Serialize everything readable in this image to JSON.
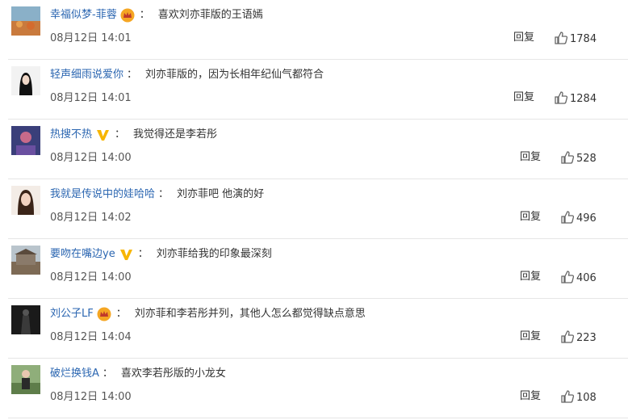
{
  "comments": [
    {
      "username": "幸福似梦-菲蓉",
      "badge": "crown-badge",
      "text": "喜欢刘亦菲版的王语嫣",
      "time": "08月12日 14:01",
      "reply": "回复",
      "likes": "1784"
    },
    {
      "username": "轻声细雨说爱你",
      "badge": "",
      "text": "刘亦菲版的，因为长相年纪仙气都符合",
      "time": "08月12日 14:01",
      "reply": "回复",
      "likes": "1284"
    },
    {
      "username": "热搜不热",
      "badge": "v-badge",
      "text": "我觉得还是李若彤",
      "time": "08月12日 14:00",
      "reply": "回复",
      "likes": "528"
    },
    {
      "username": "我就是传说中的娃哈哈",
      "badge": "",
      "text": "刘亦菲吧 他演的好",
      "time": "08月12日 14:02",
      "reply": "回复",
      "likes": "496"
    },
    {
      "username": "要吻在嘴边ye",
      "badge": "v-badge",
      "text": "刘亦菲给我的印象最深刻",
      "time": "08月12日 14:00",
      "reply": "回复",
      "likes": "406"
    },
    {
      "username": "刘公子LF",
      "badge": "crown-badge",
      "text": "刘亦菲和李若彤并列，其他人怎么都觉得缺点意思",
      "time": "08月12日 14:04",
      "reply": "回复",
      "likes": "223"
    },
    {
      "username": "破烂换钱A",
      "badge": "",
      "text": "喜欢李若彤版的小龙女",
      "time": "08月12日 14:00",
      "reply": "回复",
      "likes": "108"
    }
  ],
  "colon": "：",
  "colors": {
    "username": "#2b66b1",
    "crown": "#f5a623",
    "v_badge": "#f7b500",
    "divider": "#e6e6e6"
  }
}
